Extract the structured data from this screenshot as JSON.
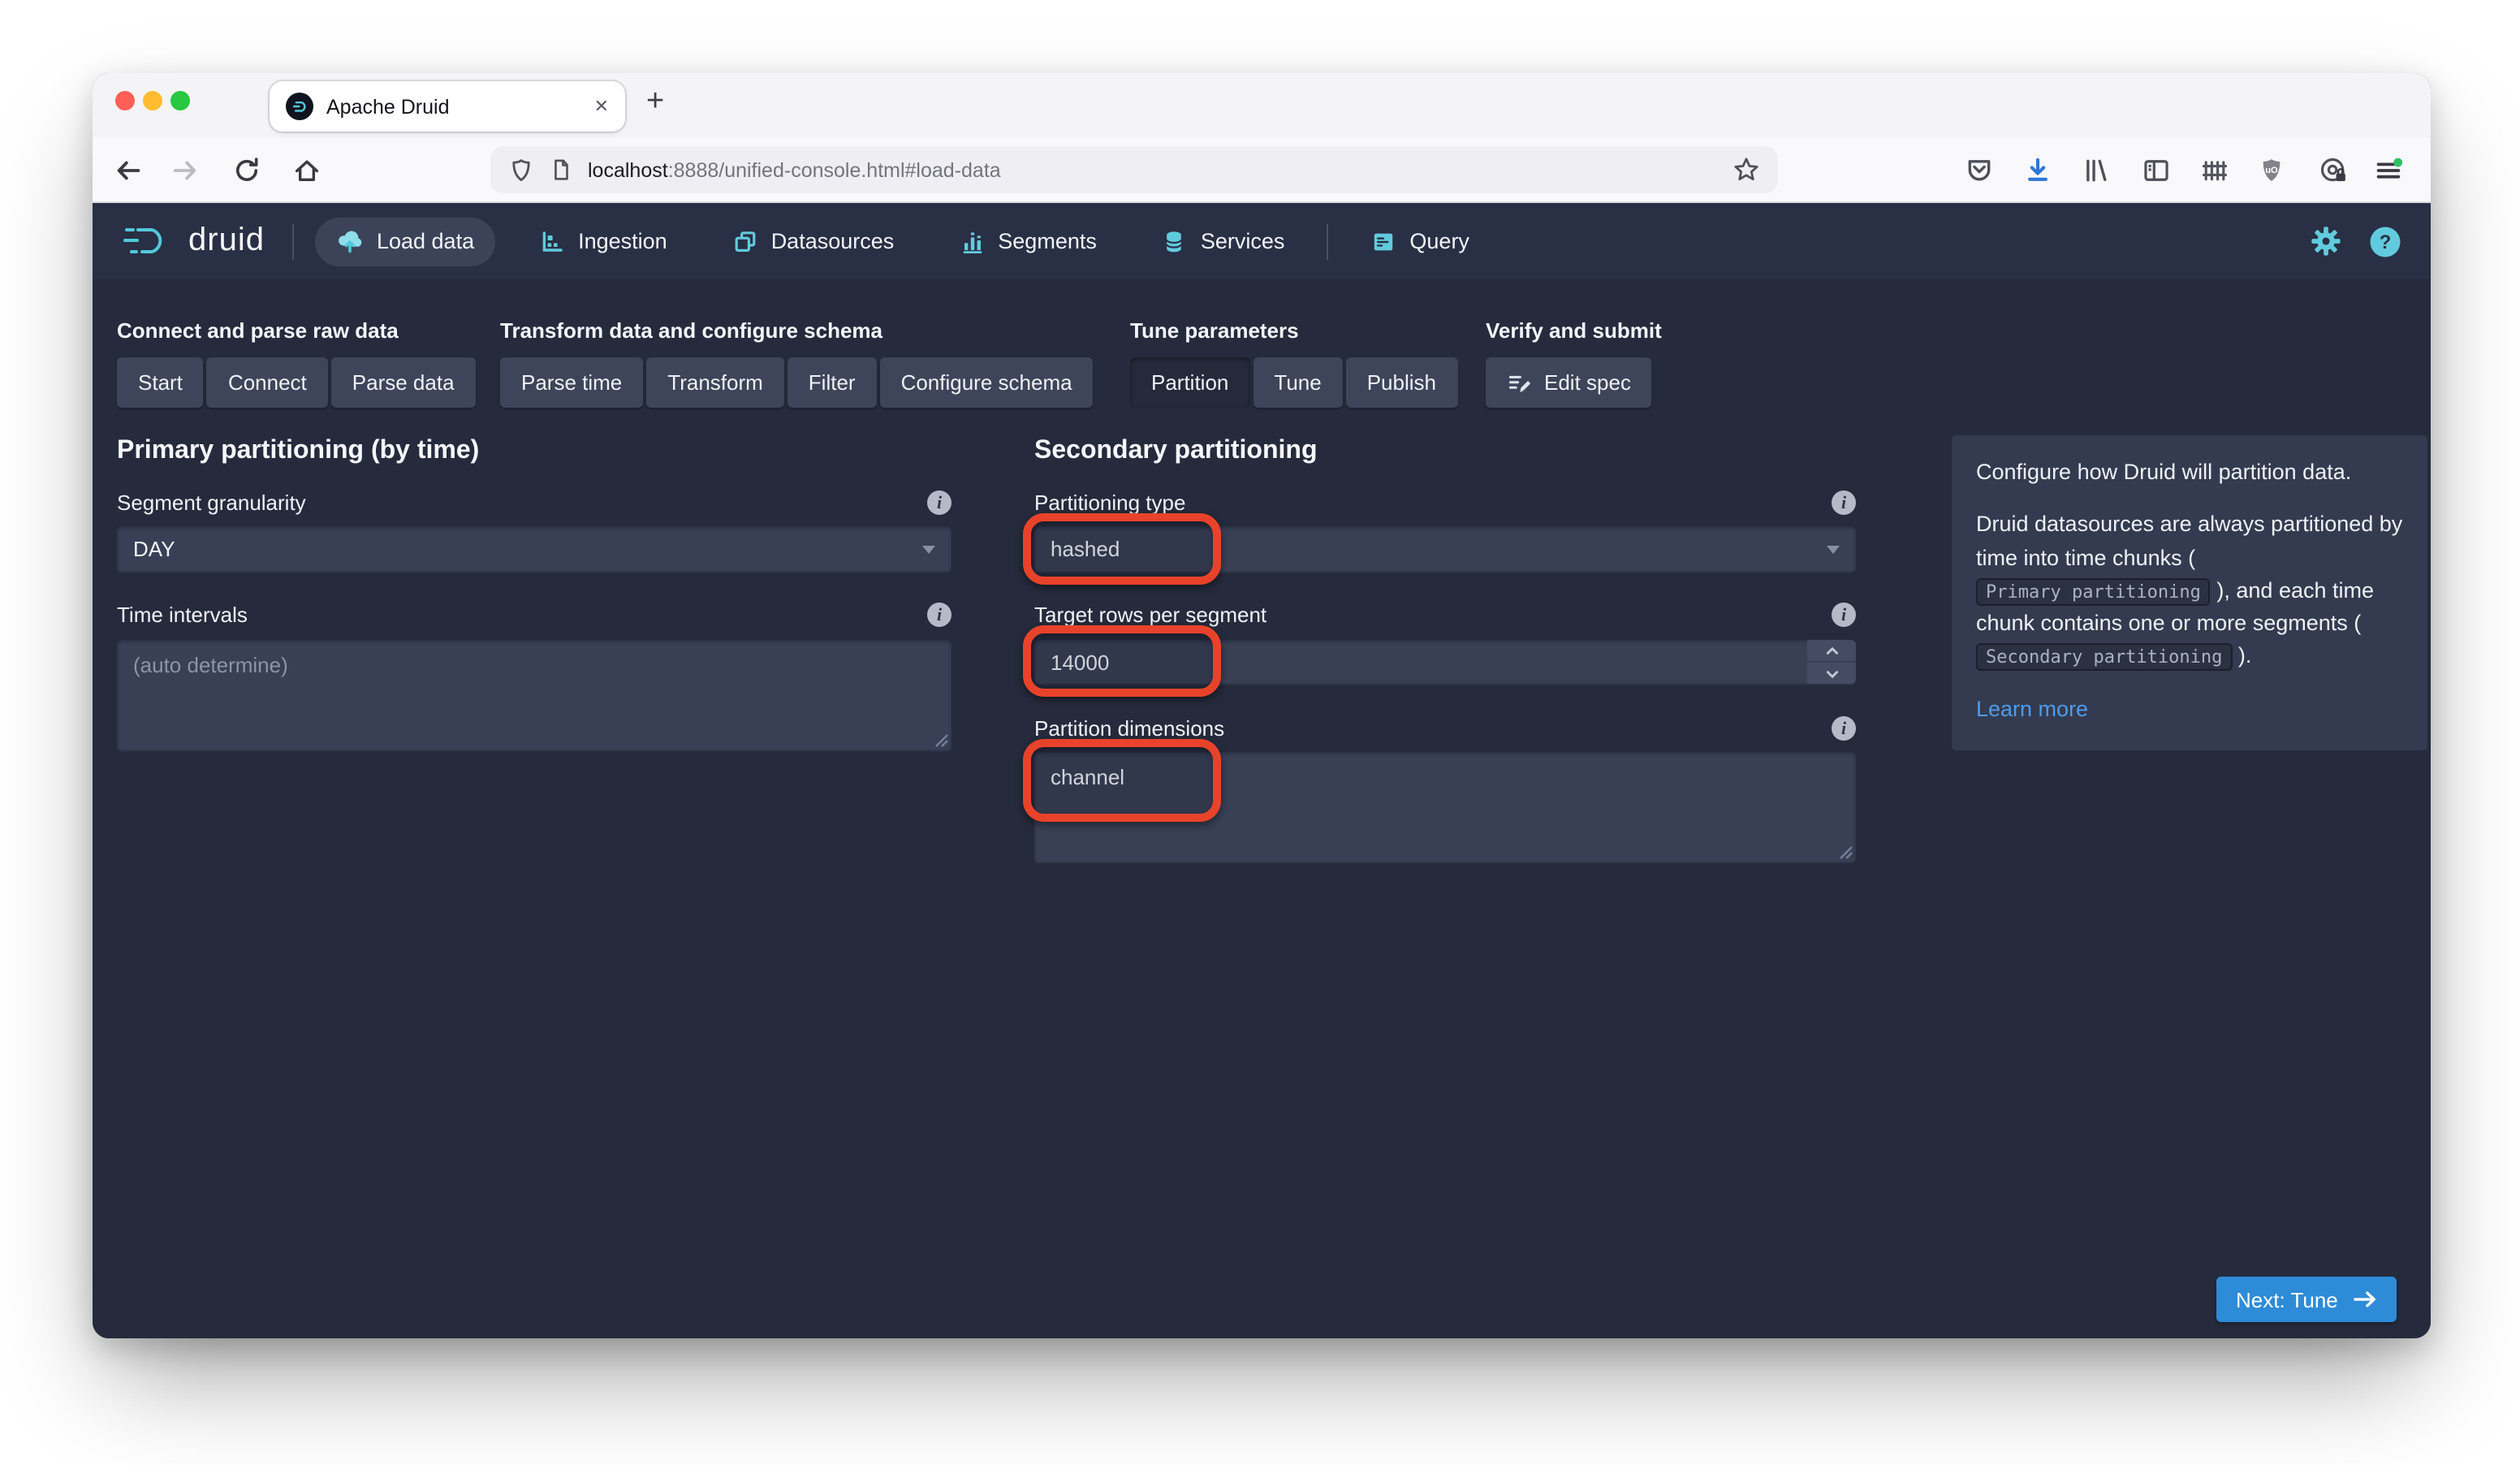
{
  "browser": {
    "tab": {
      "title": "Apache Druid",
      "close_glyph": "✕",
      "new_tab_glyph": "+"
    },
    "url": {
      "host": "localhost",
      "rest": ":8888/unified-console.html#load-data"
    }
  },
  "navbar": {
    "brand": "druid",
    "items": [
      {
        "label": "Load data"
      },
      {
        "label": "Ingestion"
      },
      {
        "label": "Datasources"
      },
      {
        "label": "Segments"
      },
      {
        "label": "Services"
      },
      {
        "label": "Query"
      }
    ]
  },
  "steps": {
    "groups": [
      {
        "title": "Connect and parse raw data",
        "buttons": [
          "Start",
          "Connect",
          "Parse data"
        ]
      },
      {
        "title": "Transform data and configure schema",
        "buttons": [
          "Parse time",
          "Transform",
          "Filter",
          "Configure schema"
        ]
      },
      {
        "title": "Tune parameters",
        "buttons": [
          "Partition",
          "Tune",
          "Publish"
        ],
        "active_button": "Partition"
      },
      {
        "title": "Verify and submit",
        "buttons": [
          "Edit spec"
        ]
      }
    ]
  },
  "primary_partitioning": {
    "title": "Primary partitioning (by time)",
    "segment_granularity_label": "Segment granularity",
    "segment_granularity_value": "DAY",
    "time_intervals_label": "Time intervals",
    "time_intervals_placeholder": "(auto determine)"
  },
  "secondary_partitioning": {
    "title": "Secondary partitioning",
    "partitioning_type_label": "Partitioning type",
    "partitioning_type_value": "hashed",
    "target_rows_label": "Target rows per segment",
    "target_rows_value": "14000",
    "partition_dimensions_label": "Partition dimensions",
    "partition_dimensions_value": "channel"
  },
  "info_panel": {
    "p1": "Configure how Druid will partition data.",
    "p2_part1": "Druid datasources are always partitioned by time into time chunks ( ",
    "code1": "Primary partitioning",
    "p2_part2": " ), and each time chunk contains one or more segments ( ",
    "code2": "Secondary partitioning",
    "p2_part3": " ).",
    "link": "Learn more"
  },
  "footer": {
    "next_button": "Next: Tune"
  },
  "colors": {
    "accent_cyan": "#61cbdd",
    "highlight_red": "#e8432a",
    "primary_blue": "#2e8bd7",
    "link_blue": "#4f9bea",
    "content_bg": "#252b3c",
    "navbar_bg": "#292f44",
    "panel_bg": "#343b50",
    "control_bg": "#394056"
  }
}
